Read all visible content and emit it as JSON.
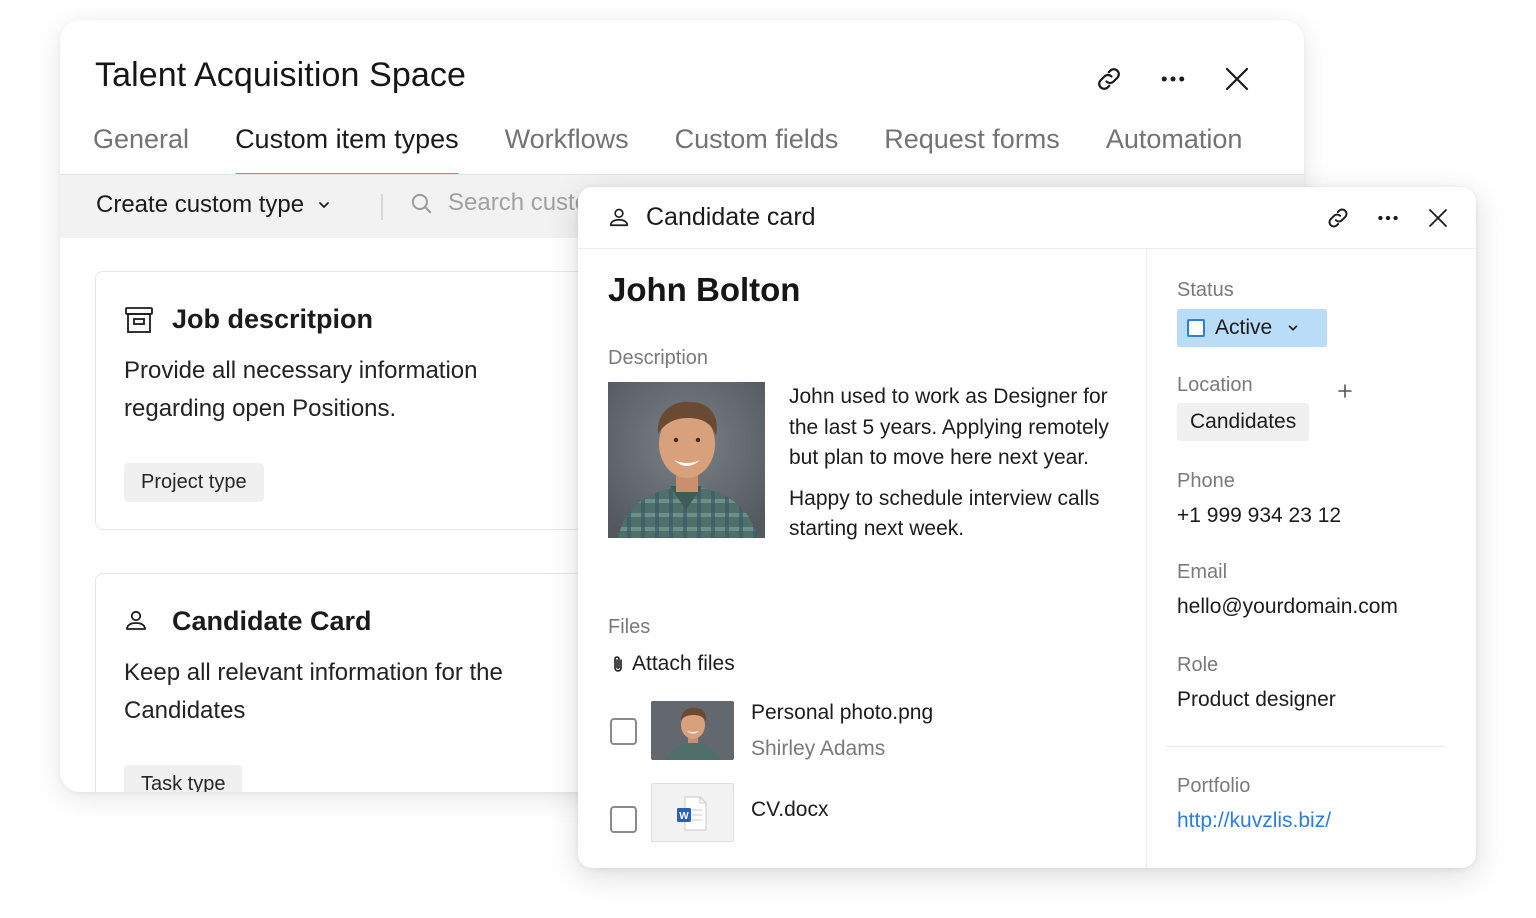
{
  "space": {
    "title": "Talent Acquisition Space",
    "tabs": [
      {
        "label": "General"
      },
      {
        "label": "Custom item types",
        "active": true
      },
      {
        "label": "Workflows"
      },
      {
        "label": "Custom fields"
      },
      {
        "label": "Request forms"
      },
      {
        "label": "Automation"
      }
    ],
    "toolbar": {
      "create_label": "Create custom type",
      "search_placeholder": "Search custom types"
    },
    "cards": [
      {
        "title": "Job descritpion",
        "icon": "archive-icon",
        "description": "Provide all necessary information regarding open Positions.",
        "chip": "Project type"
      },
      {
        "title": "Candidate Card",
        "icon": "person-icon",
        "description": "Keep all relevant information for the Candidates",
        "chip": "Task type"
      }
    ]
  },
  "candidate": {
    "header_title": "Candidate card",
    "name": "John Bolton",
    "description_label": "Description",
    "description_paragraphs": [
      "John used to work as Designer for the last 5 years. Applying remotely but plan to move here next year.",
      "Happy to schedule interview calls starting next week."
    ],
    "files_label": "Files",
    "attach_label": "Attach files",
    "files": [
      {
        "name": "Personal photo.png",
        "owner": "Shirley Adams",
        "type": "image"
      },
      {
        "name": "CV.docx",
        "owner": "",
        "type": "word"
      }
    ],
    "status": {
      "label": "Status",
      "value": "Active"
    },
    "location": {
      "label": "Location",
      "value": "Candidates"
    },
    "phone": {
      "label": "Phone",
      "value": "+1 999 934 23 12"
    },
    "email": {
      "label": "Email",
      "value": "hello@yourdomain.com"
    },
    "role": {
      "label": "Role",
      "value": "Product designer"
    },
    "portfolio": {
      "label": "Portfolio",
      "value": "http://kuvzlis.biz/"
    }
  },
  "colors": {
    "accent": "#5aa2ec",
    "status_bg": "#b9dcf7",
    "link": "#2a7de1"
  }
}
